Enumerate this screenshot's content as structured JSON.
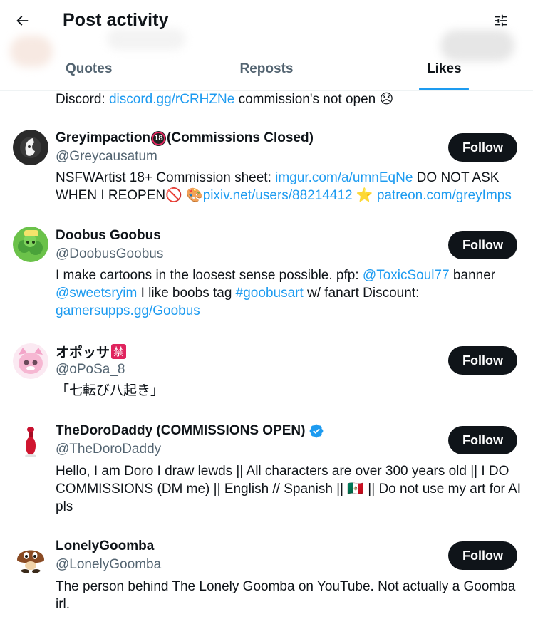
{
  "header": {
    "title": "Post activity",
    "back_icon": "back-arrow-icon",
    "settings_icon": "sliders-icon"
  },
  "tabs": [
    {
      "label": "Quotes",
      "active": false
    },
    {
      "label": "Reposts",
      "active": false
    },
    {
      "label": "Likes",
      "active": true
    }
  ],
  "partial_bio": {
    "prefix": "Discord: ",
    "link": "discord.gg/rCRHZNe",
    "suffix": " commission's not open ",
    "emoji": "😞"
  },
  "users": [
    {
      "name": "Greyimpaction",
      "name_suffix": "(Commissions Closed)",
      "badge_text": "18",
      "handle": "@Greycausatum",
      "follow_label": "Follow",
      "bio": {
        "t1": "NSFWArtist 18+ Commission sheet: ",
        "l1": "imgur.com/a/umnEqNe",
        "t2": " DO NOT ASK WHEN I REOPEN",
        "e1": "🚫",
        "e2": " 🎨",
        "l2": "pixiv.net/users/88214412",
        "e3": " ⭐ ",
        "l3": "patreon.com/greyImps"
      }
    },
    {
      "name": "Doobus Goobus",
      "handle": "@DoobusGoobus",
      "follow_label": "Follow",
      "bio": {
        "t1": "I make cartoons in the loosest sense possible. pfp: ",
        "l1": "@ToxicSoul77",
        "t2": " banner ",
        "l2": "@sweetsryim",
        "t3": " I like boobs tag ",
        "l3": "#goobusart",
        "t4": " w/ fanart Discount: ",
        "l4": "gamersupps.gg/Goobus"
      }
    },
    {
      "name": "オポッサ",
      "badge_text": "禁",
      "handle": "@oPoSa_8",
      "follow_label": "Follow",
      "bio": {
        "t1": "「七転び八起き」"
      }
    },
    {
      "name": "TheDoroDaddy (COMMISSIONS OPEN)",
      "verified": true,
      "handle": "@TheDoroDaddy",
      "follow_label": "Follow",
      "bio": {
        "t1": "Hello, I am Doro I draw lewds || All characters are over 300 years old || I DO COMMISSIONS (DM me) || English // Spanish || ",
        "e1": "🇲🇽",
        "t2": " || Do not use my art for AI pls"
      }
    },
    {
      "name": "LonelyGoomba",
      "handle": "@LonelyGoomba",
      "follow_label": "Follow",
      "bio": {
        "t1": "The person behind The Lonely Goomba on YouTube. Not actually a Goomba irl."
      }
    }
  ],
  "colors": {
    "accent": "#1d9bf0",
    "text": "#0f1419",
    "secondary": "#536471",
    "button": "#0f1419"
  }
}
